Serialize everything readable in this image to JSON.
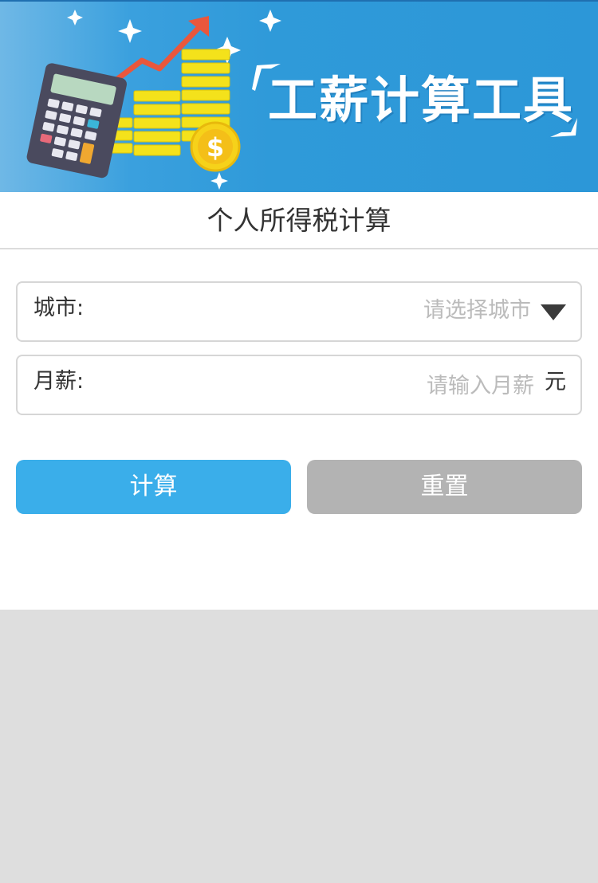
{
  "banner": {
    "title": "工薪计算工具",
    "colors": {
      "background": "#2c97d8",
      "coin": "#f4e21b",
      "arrow": "#e9573c",
      "calculator": "#4a4a5e"
    },
    "icons": [
      "calculator-icon",
      "growth-arrow-icon",
      "coin-stack-icon",
      "dollar-coin-icon",
      "sparkle-icon"
    ]
  },
  "page": {
    "title": "个人所得税计算"
  },
  "form": {
    "city": {
      "label": "城市:",
      "placeholder": "请选择城市"
    },
    "salary": {
      "label": "月薪:",
      "placeholder": "请输入月薪",
      "unit": "元",
      "value": ""
    }
  },
  "buttons": {
    "calculate": "计算",
    "reset": "重置"
  },
  "colors": {
    "primary_button": "#3aaeea",
    "secondary_button": "#b3b3b3",
    "placeholder_text": "#bbbbbb"
  }
}
